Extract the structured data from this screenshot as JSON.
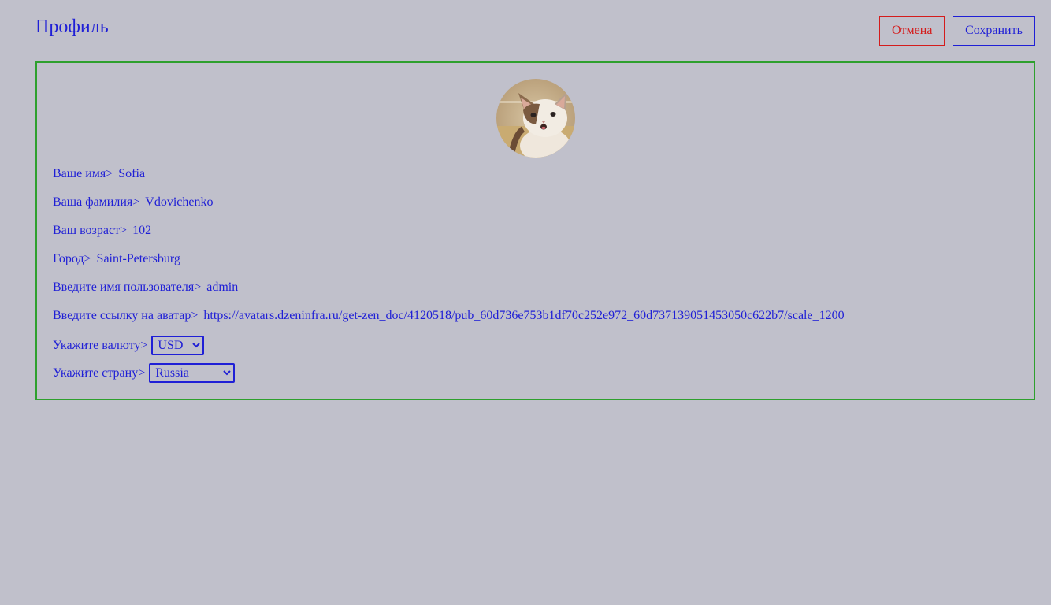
{
  "header": {
    "title": "Профиль",
    "cancel_label": "Отмена",
    "save_label": "Сохранить"
  },
  "form": {
    "first_name": {
      "label": "Ваше имя>",
      "value": "Sofia"
    },
    "last_name": {
      "label": "Ваша фамилия>",
      "value": "Vdovichenko"
    },
    "age": {
      "label": "Ваш возраст>",
      "value": "102"
    },
    "city": {
      "label": "Город>",
      "value": "Saint-Petersburg"
    },
    "username": {
      "label": "Введите имя пользователя>",
      "value": "admin"
    },
    "avatar_url": {
      "label": "Введите ссылку на аватар>",
      "value": "https://avatars.dzeninfra.ru/get-zen_doc/4120518/pub_60d736e753b1df70c252e972_60d737139051453050c622b7/scale_1200"
    },
    "currency": {
      "label": "Укажите валюту>",
      "value": "USD"
    },
    "country": {
      "label": "Укажите страну>",
      "value": "Russia"
    }
  },
  "colors": {
    "text": "#1f1fd6",
    "cancel": "#d41c1c",
    "card_border": "#2ea02e",
    "background": "#c0c0cb"
  },
  "icons": {
    "avatar": "cat-avatar-image"
  }
}
